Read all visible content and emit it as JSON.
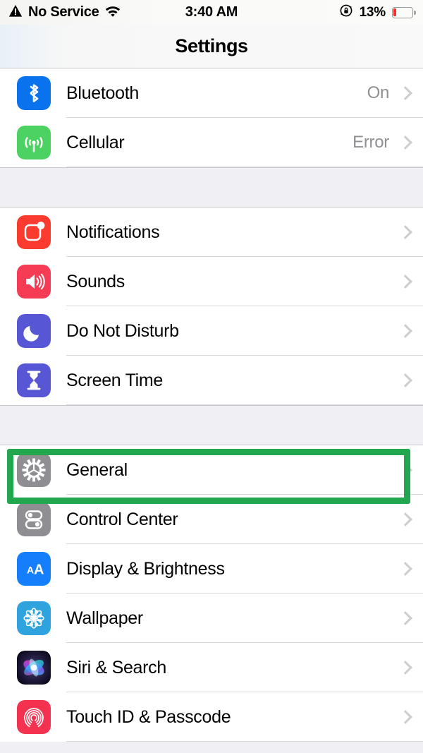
{
  "status_bar": {
    "carrier": "No Service",
    "warning_icon": "warning-triangle-icon",
    "wifi_icon": "wifi-icon",
    "time": "3:40 AM",
    "rotation_lock_icon": "rotation-lock-icon",
    "battery_percent": "13%",
    "battery_level": 13,
    "battery_color": "#F52C2C"
  },
  "nav": {
    "title": "Settings"
  },
  "annotation": {
    "target": "General",
    "color": "#22A74F",
    "shape": "rectangle-outline"
  },
  "groups": [
    {
      "id": "connectivity",
      "rows": [
        {
          "label": "Bluetooth",
          "value": "On",
          "icon": "bluetooth-icon",
          "icon_color": "#0B72ED"
        },
        {
          "label": "Cellular",
          "value": "Error",
          "icon": "cellular-icon",
          "icon_color": "#4CD263"
        }
      ]
    },
    {
      "id": "alerts",
      "rows": [
        {
          "label": "Notifications",
          "value": "",
          "icon": "notifications-icon",
          "icon_color": "#FB3B30"
        },
        {
          "label": "Sounds",
          "value": "",
          "icon": "sounds-icon",
          "icon_color": "#F63B55"
        },
        {
          "label": "Do Not Disturb",
          "value": "",
          "icon": "do-not-disturb-icon",
          "icon_color": "#5756D5"
        },
        {
          "label": "Screen Time",
          "value": "",
          "icon": "screen-time-icon",
          "icon_color": "#5756D5"
        }
      ]
    },
    {
      "id": "system",
      "rows": [
        {
          "label": "General",
          "value": "",
          "icon": "gear-icon",
          "icon_color": "#8E8E93"
        },
        {
          "label": "Control Center",
          "value": "",
          "icon": "control-center-icon",
          "icon_color": "#8E8E93"
        },
        {
          "label": "Display & Brightness",
          "value": "",
          "icon": "display-icon",
          "icon_color": "#157EFB"
        },
        {
          "label": "Wallpaper",
          "value": "",
          "icon": "wallpaper-icon",
          "icon_color": "#2EA3DE"
        },
        {
          "label": "Siri & Search",
          "value": "",
          "icon": "siri-icon",
          "icon_color": "#1B1431"
        },
        {
          "label": "Touch ID & Passcode",
          "value": "",
          "icon": "touch-id-icon",
          "icon_color": "#F4314E"
        }
      ]
    }
  ]
}
